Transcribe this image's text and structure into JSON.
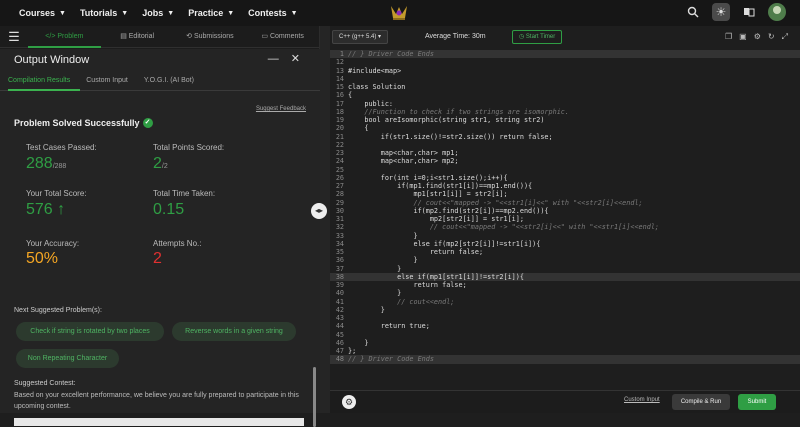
{
  "nav": {
    "items": [
      "Courses",
      "Tutorials",
      "Jobs",
      "Practice",
      "Contests"
    ],
    "icons": [
      "search-icon",
      "theme-toggle-icon",
      "translate-icon",
      "avatar"
    ]
  },
  "left_tabs": [
    "Problem",
    "Editorial",
    "Submissions",
    "Comments"
  ],
  "output": {
    "title": "Output Window",
    "tabs": [
      "Compilation Results",
      "Custom Input",
      "Y.O.G.I. (AI Bot)"
    ],
    "suggest_feedback": "Suggest Feedback",
    "status": "Problem Solved Successfully",
    "stats": {
      "test_cases_label": "Test Cases Passed:",
      "test_cases_value": "288",
      "test_cases_total": "/288",
      "points_label": "Total Points Scored:",
      "points_value": "2",
      "points_total": "/2",
      "score_label": "Your Total Score:",
      "score_value": "576",
      "time_label": "Total Time Taken:",
      "time_value": "0.15",
      "accuracy_label": "Your Accuracy:",
      "accuracy_value": "50%",
      "attempts_label": "Attempts No.:",
      "attempts_value": "2"
    },
    "next_label": "Next Suggested Problem(s):",
    "suggestions": [
      "Check if string is rotated by two places",
      "Reverse words in a given string",
      "Non Repeating Character"
    ],
    "contest_label": "Suggested Contest:",
    "contest_text": "Based on your excellent performance, we believe you are fully prepared to participate in this upcoming contest."
  },
  "editor": {
    "language": "C++ (g++ 5.4)",
    "average_time": "Average Time: 30m",
    "timer": "Start Timer",
    "lines": [
      {
        "n": "1",
        "t": "// } Driver Code Ends"
      },
      {
        "n": "12",
        "t": ""
      },
      {
        "n": "13",
        "t": "#include<map>"
      },
      {
        "n": "14",
        "t": ""
      },
      {
        "n": "15",
        "t": "class Solution"
      },
      {
        "n": "16",
        "t": "{"
      },
      {
        "n": "17",
        "t": "    public:"
      },
      {
        "n": "18",
        "t": "    //Function to check if two strings are isomorphic."
      },
      {
        "n": "19",
        "t": "    bool areIsomorphic(string str1, string str2)"
      },
      {
        "n": "20",
        "t": "    {"
      },
      {
        "n": "21",
        "t": "        if(str1.size()!=str2.size()) return false;"
      },
      {
        "n": "22",
        "t": ""
      },
      {
        "n": "23",
        "t": "        map<char,char> mp1;"
      },
      {
        "n": "24",
        "t": "        map<char,char> mp2;"
      },
      {
        "n": "25",
        "t": ""
      },
      {
        "n": "26",
        "t": "        for(int i=0;i<str1.size();i++){"
      },
      {
        "n": "27",
        "t": "            if(mp1.find(str1[i])==mp1.end()){"
      },
      {
        "n": "28",
        "t": "                mp1[str1[i]] = str2[i];"
      },
      {
        "n": "29",
        "t": "                // cout<<\"mapped -> \"<<str1[i]<<\" with \"<<str2[i]<<endl;"
      },
      {
        "n": "30",
        "t": "                if(mp2.find(str2[i])==mp2.end()){"
      },
      {
        "n": "31",
        "t": "                    mp2[str2[i]] = str1[i];"
      },
      {
        "n": "32",
        "t": "                    // cout<<\"mapped -> \"<<str2[i]<<\" with \"<<str1[i]<<endl;"
      },
      {
        "n": "33",
        "t": "                }"
      },
      {
        "n": "34",
        "t": "                else if(mp2[str2[i]]!=str1[i]){"
      },
      {
        "n": "35",
        "t": "                    return false;"
      },
      {
        "n": "36",
        "t": "                }"
      },
      {
        "n": "37",
        "t": "            }"
      },
      {
        "n": "38",
        "t": "            else if(mp1[str1[i]]!=str2[i]){"
      },
      {
        "n": "39",
        "t": "                return false;"
      },
      {
        "n": "40",
        "t": "            }"
      },
      {
        "n": "41",
        "t": "            // cout<<endl;"
      },
      {
        "n": "42",
        "t": "        }"
      },
      {
        "n": "43",
        "t": ""
      },
      {
        "n": "44",
        "t": "        return true;"
      },
      {
        "n": "45",
        "t": ""
      },
      {
        "n": "46",
        "t": "    }"
      },
      {
        "n": "47",
        "t": "};"
      },
      {
        "n": "48",
        "t": "// } Driver Code Ends"
      }
    ],
    "custom_input": "Custom Input",
    "compile_run": "Compile & Run",
    "submit": "Submit"
  }
}
